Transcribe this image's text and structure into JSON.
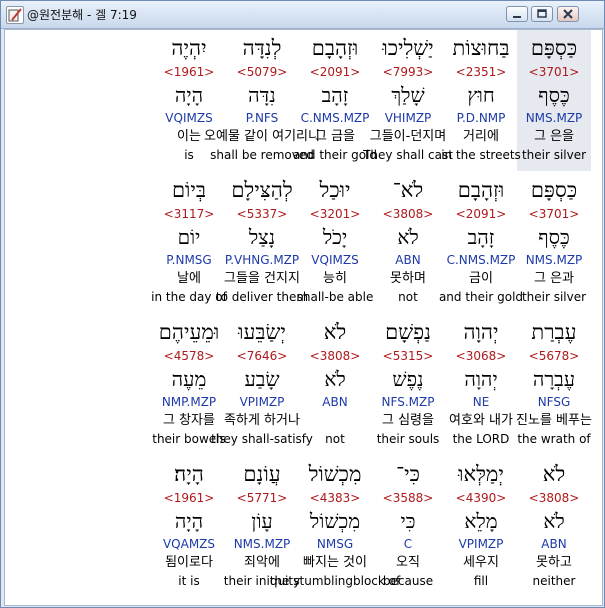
{
  "window": {
    "title": "@원전분해 - 겔 7:19",
    "icons": {
      "app": "bible-pencil-icon",
      "minimize": "minimize-icon",
      "maximize": "maximize-icon",
      "close": "close-icon"
    }
  },
  "colors": {
    "strong": "#b0181b",
    "morph": "#1d3aa8",
    "text": "#000000",
    "selected": "#e6eaf0"
  },
  "rows": [
    {
      "words": [
        {
          "hebrew": "כַּסְפָּם",
          "strong": "<3701>",
          "lemma": "כֶּסֶף",
          "morph": "NMS.MZP",
          "korean": "그 은을",
          "english": "their silver",
          "selected": true
        },
        {
          "hebrew": "בַּחוּצוֹת",
          "strong": "<2351>",
          "lemma": "חוּץ",
          "morph": "P.D.NMP",
          "korean": "거리에",
          "english": "in the streets"
        },
        {
          "hebrew": "יַשְׁלִיכוּ",
          "strong": "<7993>",
          "lemma": "שָׁלַךְ",
          "morph": "VHIMZP",
          "korean": "그들이-던지며",
          "english": "They shall cast"
        },
        {
          "hebrew": "וּזְהָבָם",
          "strong": "<2091>",
          "lemma": "זָהָב",
          "morph": "C.NMS.MZP",
          "korean": "그 금을",
          "english": "and their gold"
        },
        {
          "hebrew": "לְנִדָּה",
          "strong": "<5079>",
          "lemma": "נִדָּה",
          "morph": "P.NFS",
          "korean": "오예물 같이 여기리니",
          "english": "shall be removed"
        },
        {
          "hebrew": "יִהְיֶה",
          "strong": "<1961>",
          "lemma": "הָיָה",
          "morph": "VQIMZS",
          "korean": "이는",
          "english": "is"
        }
      ]
    },
    {
      "words": [
        {
          "hebrew": "כַּסְפָּם",
          "strong": "<3701>",
          "lemma": "כֶּסֶף",
          "morph": "NMS.MZP",
          "korean": "그 은과",
          "english": "their silver"
        },
        {
          "hebrew": "וּזְהָבָם",
          "strong": "<2091>",
          "lemma": "זָהָב",
          "morph": "C.NMS.MZP",
          "korean": "금이",
          "english": "and their gold"
        },
        {
          "hebrew": "לֹא־",
          "strong": "<3808>",
          "lemma": "לֹא",
          "morph": "ABN",
          "korean": "못하며",
          "english": "not"
        },
        {
          "hebrew": "יוּכַל",
          "strong": "<3201>",
          "lemma": "יָכֹל",
          "morph": "VQIMZS",
          "korean": "능히",
          "english": "shall-be able"
        },
        {
          "hebrew": "לְהַצִּילָם",
          "strong": "<5337>",
          "lemma": "נָצַל",
          "morph": "P.VHNG.MZP",
          "korean": "그들을 건지지",
          "english": "to deliver them"
        },
        {
          "hebrew": "בְּיוֹם",
          "strong": "<3117>",
          "lemma": "יוֹם",
          "morph": "P.NMSG",
          "korean": "날에",
          "english": "in the day of"
        }
      ]
    },
    {
      "words": [
        {
          "hebrew": "עֶבְרַת",
          "strong": "<5678>",
          "lemma": "עֶבְרָה",
          "morph": "NFSG",
          "korean": "진노를 베푸는",
          "english": "the wrath of"
        },
        {
          "hebrew": "יְהוָה",
          "strong": "<3068>",
          "lemma": "יְהוָה",
          "morph": "NE",
          "korean": "여호와 내가",
          "english": "the LORD"
        },
        {
          "hebrew": "נַפְשָׁם",
          "strong": "<5315>",
          "lemma": "נֶפֶשׁ",
          "morph": "NFS.MZP",
          "korean": "그 심령을",
          "english": "their souls"
        },
        {
          "hebrew": "לֹא",
          "strong": "<3808>",
          "lemma": "לֹא",
          "morph": "ABN",
          "korean": "",
          "english": "not"
        },
        {
          "hebrew": "יְשַׂבֵּעוּ",
          "strong": "<7646>",
          "lemma": "שָׂבַע",
          "morph": "VPIMZP",
          "korean": "족하게 하거나",
          "english": "they shall-satisfy"
        },
        {
          "hebrew": "וּמֵעֵיהֶם",
          "strong": "<4578>",
          "lemma": "מֵעֶה",
          "morph": "NMP.MZP",
          "korean": "그 창자를",
          "english": "their bowels"
        }
      ]
    },
    {
      "words": [
        {
          "hebrew": "לֹא",
          "strong": "<3808>",
          "lemma": "לֹא",
          "morph": "ABN",
          "korean": "못하고",
          "english": "neither"
        },
        {
          "hebrew": "יְמַלְּאוּ",
          "strong": "<4390>",
          "lemma": "מָלֵא",
          "morph": "VPIMZP",
          "korean": "세우지",
          "english": "fill"
        },
        {
          "hebrew": "כִּי־",
          "strong": "<3588>",
          "lemma": "כִּי",
          "morph": "C",
          "korean": "오직",
          "english": "because"
        },
        {
          "hebrew": "מִכְשׁוֹל",
          "strong": "<4383>",
          "lemma": "מִכְשׁוֹל",
          "morph": "NMSG",
          "korean": "빠지는 것이",
          "english": "the stumblingblock of"
        },
        {
          "hebrew": "עֲוֹנָם",
          "strong": "<5771>",
          "lemma": "עָוֹן",
          "morph": "NMS.MZP",
          "korean": "죄악에",
          "english": "their iniquity"
        },
        {
          "hebrew": "הָיָה׃",
          "strong": "<1961>",
          "lemma": "הָיָה",
          "morph": "VQAMZS",
          "korean": "됨이로다",
          "english": "it is"
        }
      ]
    }
  ]
}
